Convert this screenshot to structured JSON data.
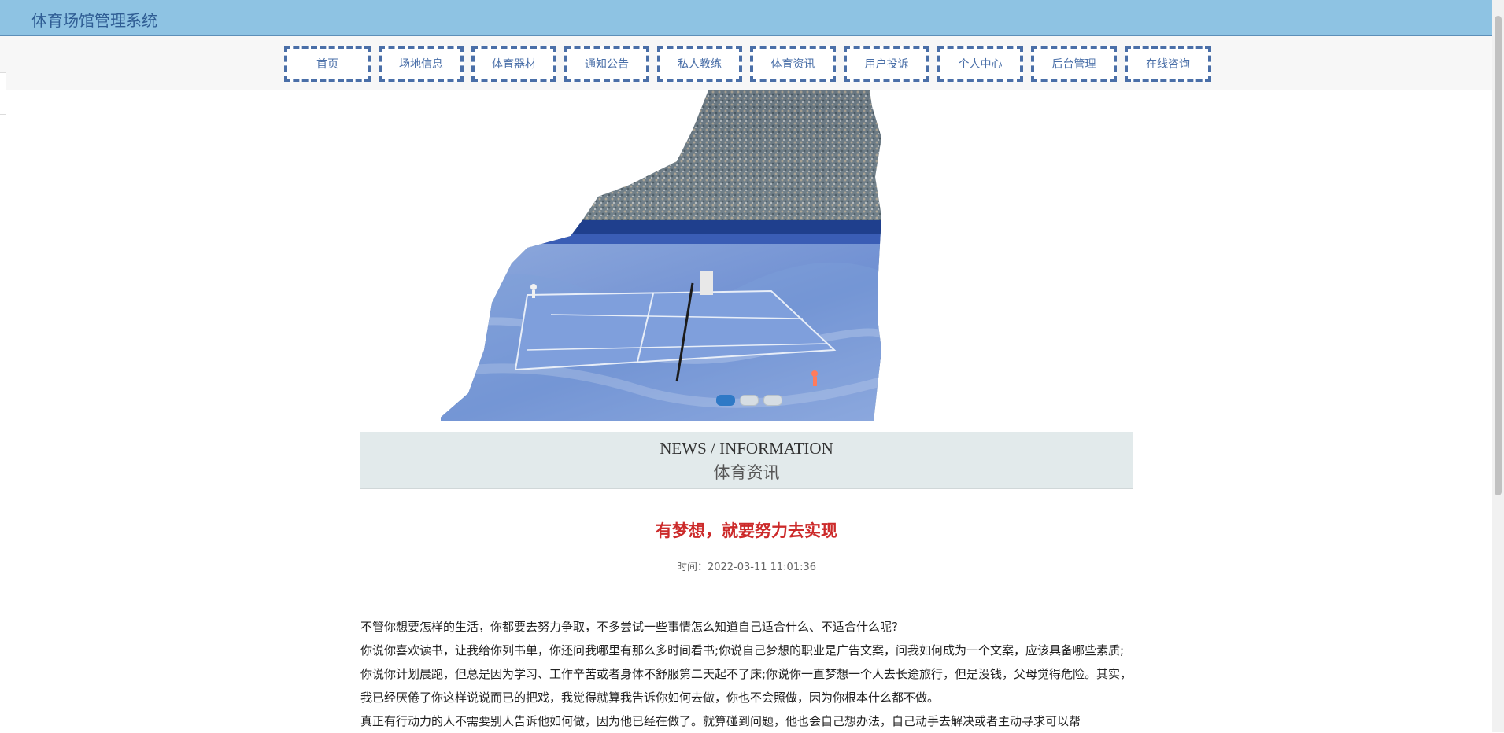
{
  "app": {
    "title": "体育场馆管理系统"
  },
  "nav": {
    "items": [
      {
        "label": "首页"
      },
      {
        "label": "场地信息"
      },
      {
        "label": "体育器材"
      },
      {
        "label": "通知公告"
      },
      {
        "label": "私人教练"
      },
      {
        "label": "体育资讯"
      },
      {
        "label": "用户投诉"
      },
      {
        "label": "个人中心"
      },
      {
        "label": "后台管理"
      },
      {
        "label": "在线咨询"
      }
    ]
  },
  "carousel": {
    "image_desc": "tennis-stadium-image",
    "slides": 3,
    "active_index": 0
  },
  "section": {
    "title_en": "NEWS / INFORMATION",
    "title_cn": "体育资讯"
  },
  "article": {
    "title": "有梦想，就要努力去实现",
    "meta": "时间：2022-03-11 11:01:36",
    "paragraphs": [
      "不管你想要怎样的生活，你都要去努力争取，不多尝试一些事情怎么知道自己适合什么、不适合什么呢?",
      "你说你喜欢读书，让我给你列书单，你还问我哪里有那么多时间看书;你说自己梦想的职业是广告文案，问我如何成为一个文案，应该具备哪些素质;你说你计划晨跑，但总是因为学习、工作辛苦或者身体不舒服第二天起不了床;你说你一直梦想一个人去长途旅行，但是没钱，父母觉得危险。其实，我已经厌倦了你这样说说而已的把戏，我觉得就算我告诉你如何去做，你也不会照做，因为你根本什么都不做。",
      "真正有行动力的人不需要别人告诉他如何做，因为他已经在做了。就算碰到问题，他也会自己想办法，自己动手去解决或者主动寻求可以帮"
    ]
  },
  "colors": {
    "topbar": "#8ec3e3",
    "brand": "#2f5d94",
    "nav_border": "#4a6fa8",
    "section_bg": "#e2eaeb",
    "article_title": "#cc2a2a",
    "dot_active": "#2f79c6"
  }
}
